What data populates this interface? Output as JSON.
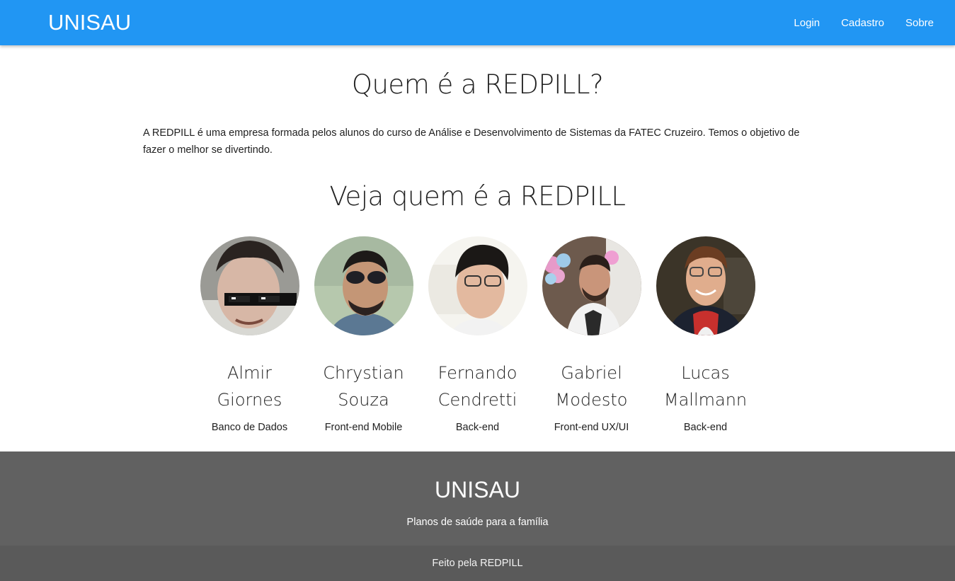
{
  "navbar": {
    "brand": "UNISAU",
    "links": [
      "Login",
      "Cadastro",
      "Sobre"
    ]
  },
  "about": {
    "title": "Quem é a REDPILL?",
    "text": "A REDPILL é uma empresa formada pelos alunos do curso de Análise e Desenvolvimento de Sistemas da FATEC Cruzeiro. Temos o objetivo de fazer o melhor se divertindo."
  },
  "team": {
    "title": "Veja quem é a REDPILL",
    "members": [
      {
        "name": "Almir Giornes",
        "role": "Banco de Dados"
      },
      {
        "name": "Chrystian Souza",
        "role": "Front-end Mobile"
      },
      {
        "name": "Fernando Cendretti",
        "role": "Back-end"
      },
      {
        "name": "Gabriel Modesto",
        "role": "Front-end UX/UI"
      },
      {
        "name": "Lucas Mallmann",
        "role": "Back-end"
      }
    ]
  },
  "footer": {
    "title": "UNISAU",
    "subtitle": "Planos de saúde para a família",
    "credit": "Feito pela REDPILL"
  },
  "colors": {
    "navbar": "#2196f3",
    "footer": "#616161",
    "footer_bottom": "#5a5a5a"
  }
}
